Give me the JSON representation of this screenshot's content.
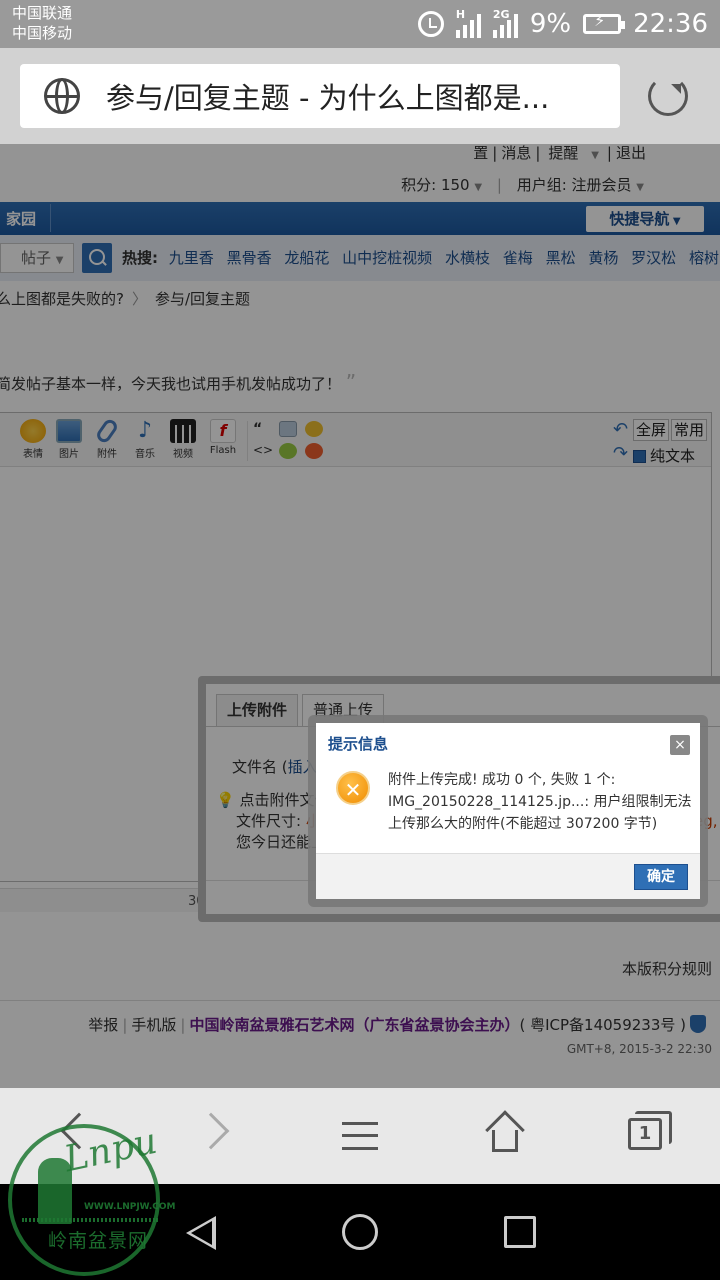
{
  "status_bar": {
    "carrier1": "中国联通",
    "carrier2": "中国移动",
    "net1": "H",
    "net2": "2G",
    "battery": "9%",
    "time": "22:36"
  },
  "browser": {
    "page_title": "参与/回复主题 - 为什么上图都是..."
  },
  "page": {
    "top_links": [
      "置",
      "消息",
      "提醒",
      "退出"
    ],
    "points": "积分: 150",
    "usergroup": "用户组: 注册会员",
    "nav_home": "家园",
    "quick_nav": "快捷导航",
    "search_type": "帖子",
    "hot_label": "热搜:",
    "hot_items": [
      "九里香",
      "黑骨香",
      "龙船花",
      "山中挖桩视频",
      "水横枝",
      "雀梅",
      "黑松",
      "黄杨",
      "罗汉松",
      "榕树"
    ],
    "breadcrumb": [
      "么上图都是失败的?",
      "参与/回复主题"
    ],
    "quote_text": "简发帖子基本一样，今天我也试用手机发帖成功了！",
    "toolbar": {
      "items": [
        "表情",
        "图片",
        "附件",
        "音乐",
        "视频",
        "Flash"
      ],
      "fullscreen": "全屏",
      "common": "常用",
      "plaintext": "纯文本"
    },
    "upload": {
      "tab_upload": "上传附件",
      "tab_normal": "普通上传",
      "filename_label": "文件名 (",
      "insert": "插入",
      "tip1": "点击附件文件",
      "tip2_label": "文件尺寸: ",
      "tip2_value": "小",
      "tip2_suffix": "eg,",
      "tip3": "您今日还能上",
      "count_30": "30"
    },
    "rules": "本版积分规则",
    "footer": {
      "report": "举报",
      "mobile": "手机版",
      "site": "中国岭南盆景雅石艺术网（广东省盆景协会主办）",
      "icp": "( 粤ICP备14059233号 )",
      "gmt": "GMT+8, 2015-3-2 22:30"
    }
  },
  "dialog": {
    "title": "提示信息",
    "close": "×",
    "line1": "附件上传完成! 成功 0 个, 失败 1 个:",
    "line2": "IMG_20150228_114125.jp...: 用户组限制无法",
    "line3": "上传那么大的附件(不能超过 307200 字节)",
    "ok": "确定"
  },
  "bottom_bar": {
    "tabs_count": "1"
  },
  "watermark": {
    "script": "Lnpu",
    "url": "WWW.LNPJW.COM",
    "name": "岭南盆景网"
  }
}
